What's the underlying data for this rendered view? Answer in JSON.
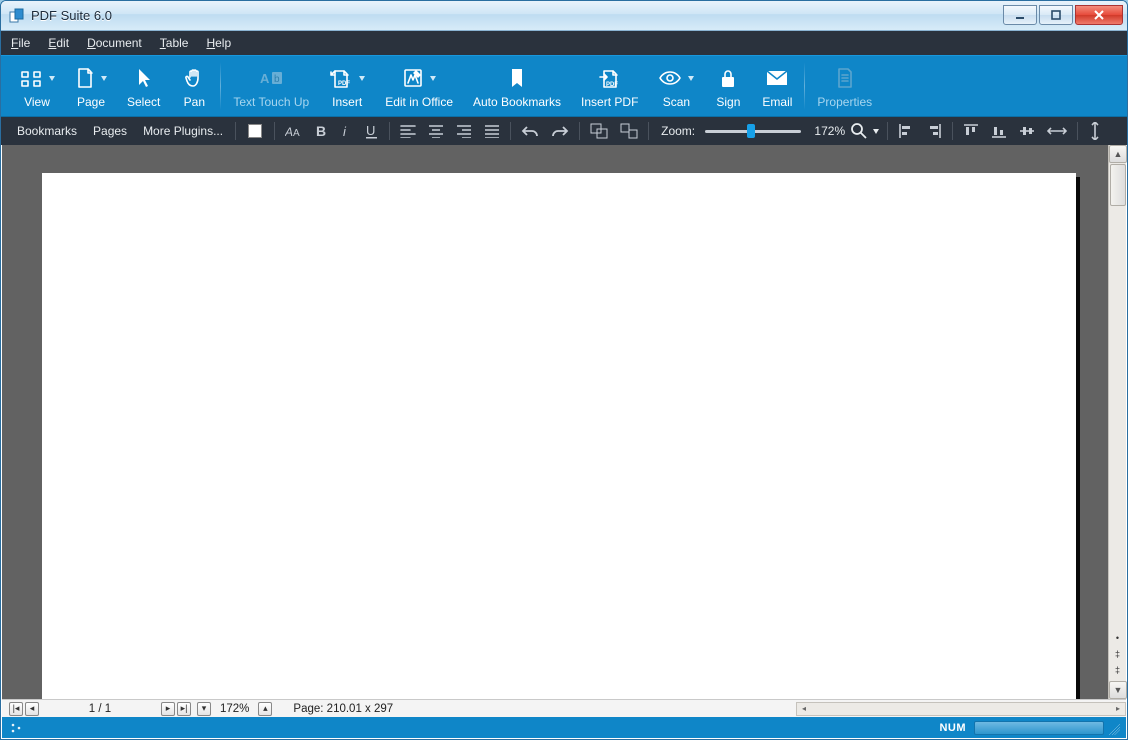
{
  "window": {
    "title": "PDF Suite 6.0"
  },
  "menu": {
    "file": "File",
    "edit": "Edit",
    "document": "Document",
    "table": "Table",
    "help": "Help"
  },
  "ribbon": {
    "view": "View",
    "page": "Page",
    "select": "Select",
    "pan": "Pan",
    "text_touch_up": "Text Touch Up",
    "insert": "Insert",
    "edit_in_office": "Edit in Office",
    "auto_bookmarks": "Auto Bookmarks",
    "insert_pdf": "Insert PDF",
    "scan": "Scan",
    "sign": "Sign",
    "email": "Email",
    "properties": "Properties"
  },
  "toolbar2": {
    "bookmarks": "Bookmarks",
    "pages": "Pages",
    "more_plugins": "More Plugins...",
    "zoom_label": "Zoom:",
    "zoom_value": "172%",
    "color_swatch": "#ffffff"
  },
  "pagenav": {
    "page_counter": "1 / 1",
    "zoom_value": "172%",
    "page_dims": "Page: 210.01 x 297"
  },
  "status": {
    "num": "NUM"
  },
  "zoom_slider_percent": 48
}
